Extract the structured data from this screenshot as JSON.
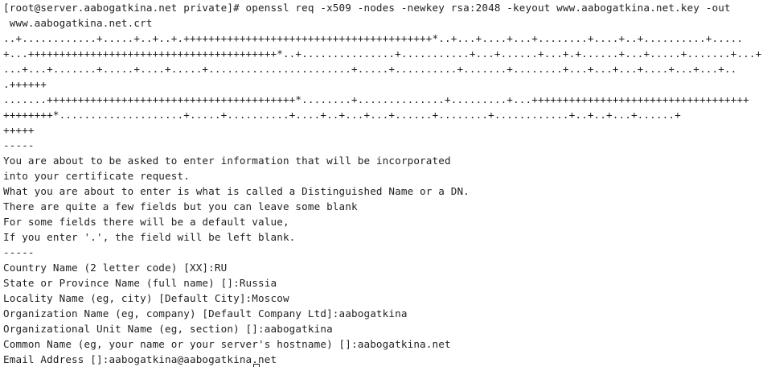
{
  "terminal": {
    "lines": [
      "[root@server.aabogatkina.net private]# openssl req -x509 -nodes -newkey rsa:2048 -keyout www.aabogatkina.net.key -out",
      " www.aabogatkina.net.crt",
      "..+............+.....+..+..+.++++++++++++++++++++++++++++++++++++++++*..+...+....+...+........+....+..+..........+.....",
      "+...++++++++++++++++++++++++++++++++++++++++*..+...............+...........+...+......+...+.+......+...+.....+.......+...+..",
      "...+...+.......+.....+....+.....+.......................+.....+..........+.......+........+...+...+...+....+...+...+..",
      ".++++++",
      ".......++++++++++++++++++++++++++++++++++++++++*........+..............+.........+...+++++++++++++++++++++++++++++++++++",
      "++++++++*....................+.....+..........+....+..+...+...+......+........+............+..+..+...+......+",
      "+++++",
      "-----",
      "You are about to be asked to enter information that will be incorporated",
      "into your certificate request.",
      "What you are about to enter is what is called a Distinguished Name or a DN.",
      "There are quite a few fields but you can leave some blank",
      "For some fields there will be a default value,",
      "If you enter '.', the field will be left blank.",
      "-----",
      "Country Name (2 letter code) [XX]:RU",
      "State or Province Name (full name) []:Russia",
      "Locality Name (eg, city) [Default City]:Moscow",
      "Organization Name (eg, company) [Default Company Ltd]:aabogatkina",
      "Organizational Unit Name (eg, section) []:aabogatkina",
      "Common Name (eg, your name or your server's hostname) []:aabogatkina.net",
      "Email Address []:aabogatkina@aabogatkina.net"
    ]
  }
}
